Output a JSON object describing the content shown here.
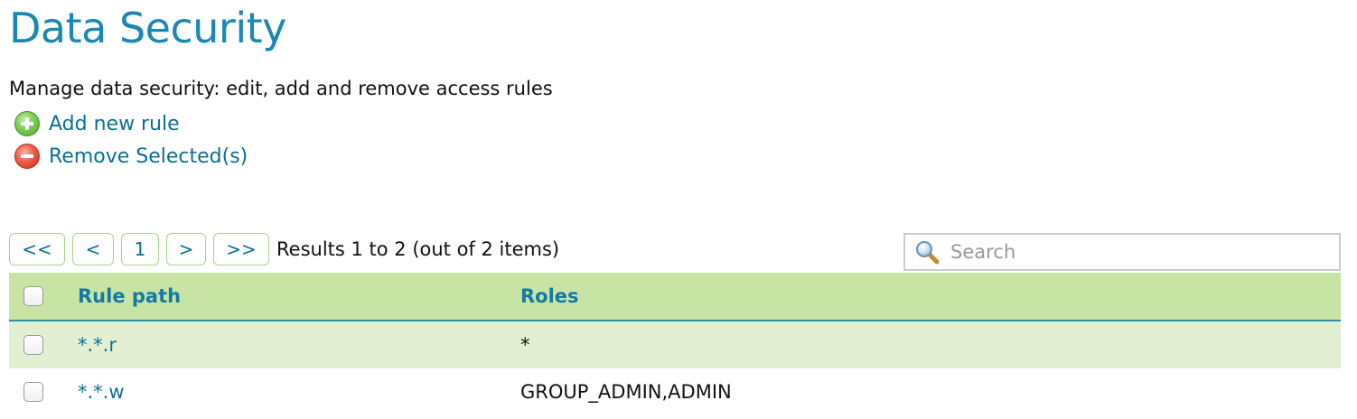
{
  "page": {
    "title": "Data Security",
    "description": "Manage data security: edit, add and remove access rules"
  },
  "actions": {
    "add_label": "Add new rule",
    "remove_label": "Remove Selected(s)"
  },
  "pager": {
    "first": "<<",
    "prev": "<",
    "current": "1",
    "next": ">",
    "last": ">>",
    "results_text": "Results 1 to 2 (out of 2 items)"
  },
  "search": {
    "placeholder": "Search",
    "value": ""
  },
  "table": {
    "columns": [
      "Rule path",
      "Roles"
    ],
    "rows": [
      {
        "path": "*.*.r",
        "roles": "*"
      },
      {
        "path": "*.*.w",
        "roles": "GROUP_ADMIN,ADMIN"
      }
    ]
  },
  "colors": {
    "accent": "#1b87b5",
    "link": "#0a6f94",
    "header_bg": "#c8e4a4",
    "alt_row_bg": "#e2efd2",
    "add_icon": "#6cc04a",
    "remove_icon": "#e84c3d"
  },
  "icons": {
    "add": "plus-circle-icon",
    "remove": "minus-circle-icon",
    "search": "magnifier-icon"
  }
}
